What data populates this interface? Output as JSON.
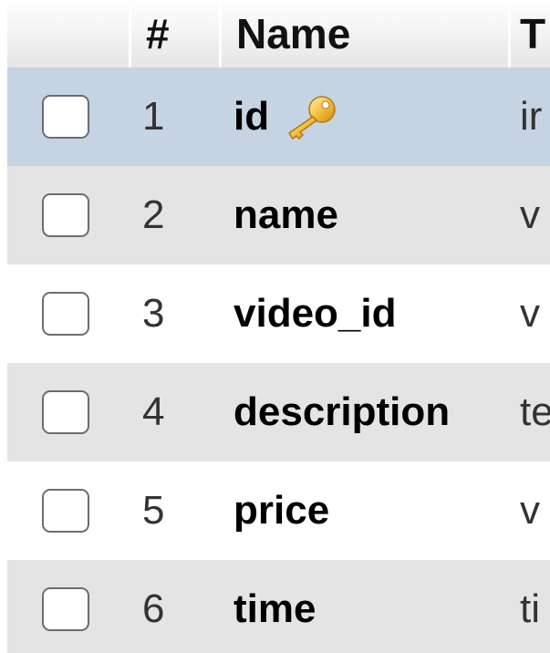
{
  "table": {
    "header": {
      "num": "#",
      "name": "Name",
      "type": "T"
    },
    "rows": [
      {
        "num": "1",
        "name": "id",
        "type": "ir",
        "primary_key": true,
        "bg": "#c6d3e2"
      },
      {
        "num": "2",
        "name": "name",
        "type": "v",
        "primary_key": false,
        "bg": "#e4e4e4"
      },
      {
        "num": "3",
        "name": "video_id",
        "type": "v",
        "primary_key": false,
        "bg": "#ffffff"
      },
      {
        "num": "4",
        "name": "description",
        "type": "te",
        "primary_key": false,
        "bg": "#e4e4e4"
      },
      {
        "num": "5",
        "name": "price",
        "type": "v",
        "primary_key": false,
        "bg": "#ffffff"
      },
      {
        "num": "6",
        "name": "time",
        "type": "ti",
        "primary_key": false,
        "bg": "#e4e4e4"
      }
    ]
  },
  "icons": {
    "primary_key": "key-icon"
  }
}
